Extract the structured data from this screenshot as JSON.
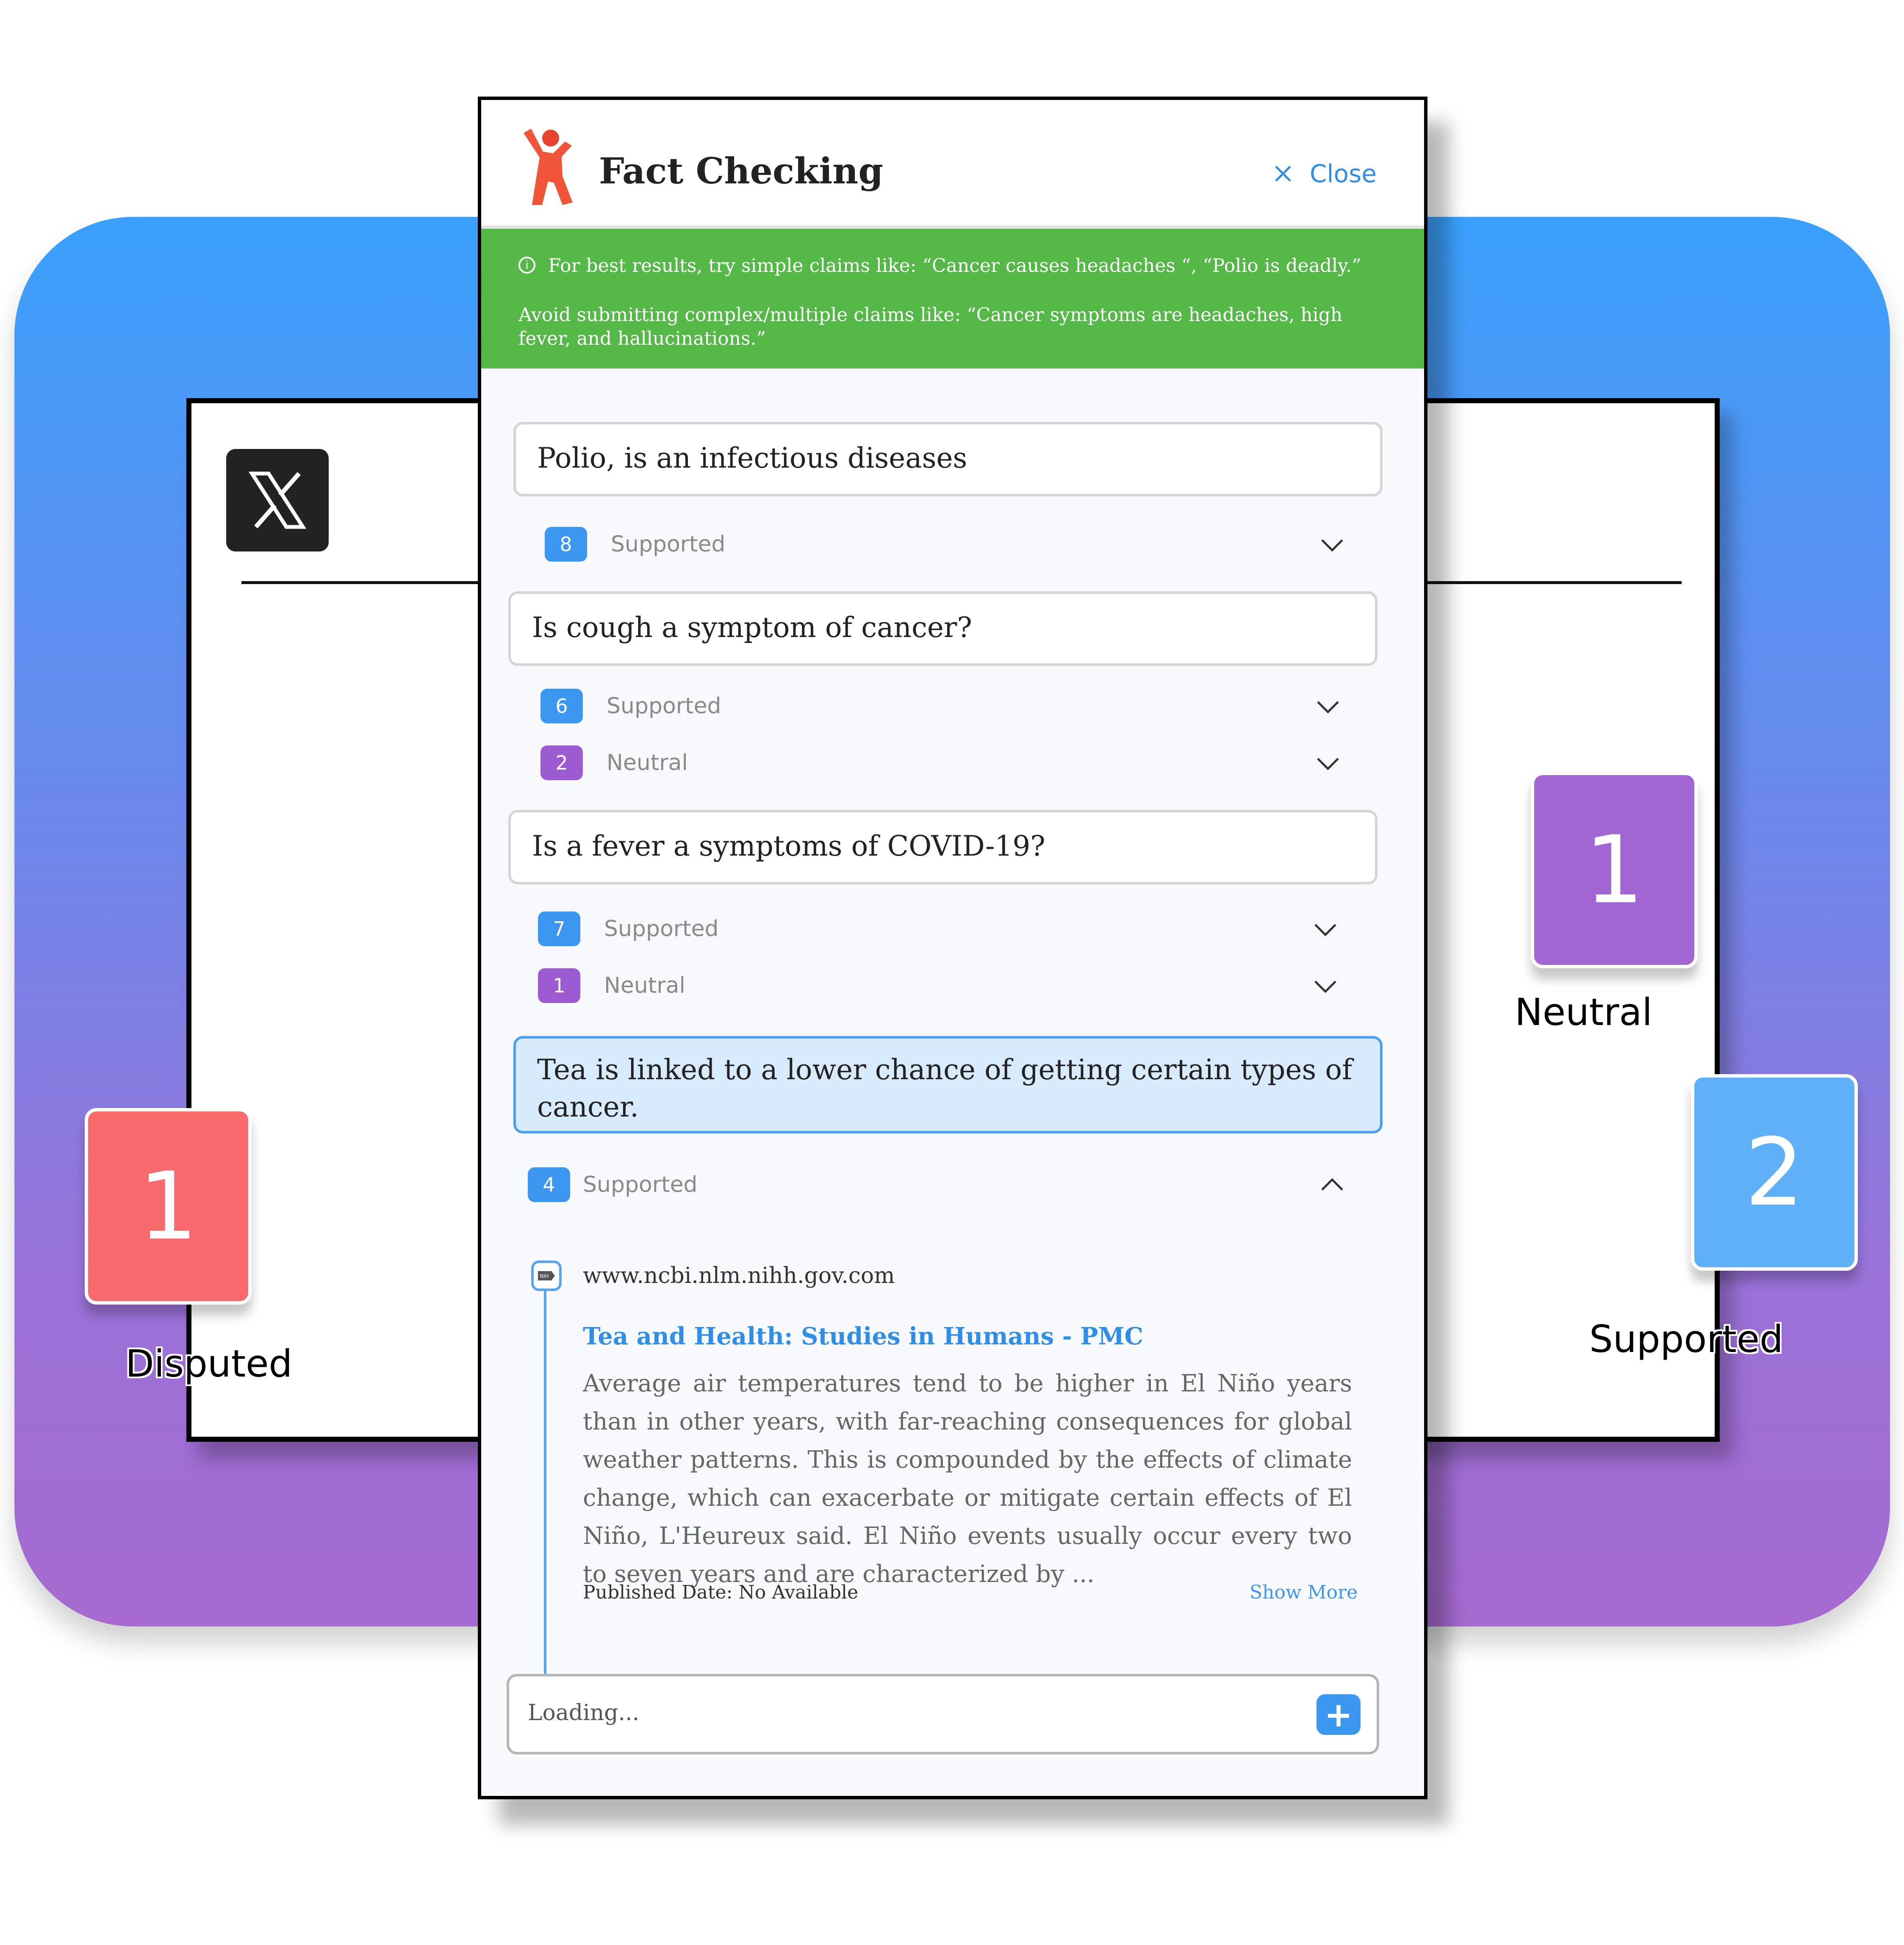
{
  "app": {
    "title": "Fact Checking",
    "close_label": "Close"
  },
  "banner": {
    "line1": "For best results, try simple claims like: “Cancer causes headaches “,  “Polio is deadly.”",
    "line2": "Avoid submitting complex/multiple claims like: “Cancer symptoms are headaches, high fever, and hallucinations.”"
  },
  "claims": [
    {
      "text": "Polio,  is an infectious diseases",
      "results": [
        {
          "count": "8",
          "label": "Supported",
          "color": "#3c97f1"
        }
      ]
    },
    {
      "text": "Is cough a symptom of cancer?",
      "results": [
        {
          "count": "6",
          "label": "Supported",
          "color": "#3c97f1"
        },
        {
          "count": "2",
          "label": "Neutral",
          "color": "#9d5bd2"
        }
      ]
    },
    {
      "text": "Is a fever a symptoms of COVID-19?",
      "results": [
        {
          "count": "7",
          "label": "Supported",
          "color": "#3c97f1"
        },
        {
          "count": "1",
          "label": "Neutral",
          "color": "#9d5bd2"
        }
      ]
    },
    {
      "text": "Tea is linked to a lower chance of getting certain types of cancer.",
      "results": [
        {
          "count": "4",
          "label": "Supported",
          "color": "#3c97f1",
          "expanded": true
        }
      ]
    }
  ],
  "source": {
    "icon_label": "NIH",
    "url": "www.ncbi.nlm.nihh.gov.com",
    "title": "Tea and Health: Studies in Humans - PMC",
    "body": "Average air temperatures tend to be higher in El Niño years than in other years, with far-reaching consequences for global weather patterns. This is compounded by the effects of climate change, which can exacerbate or mitigate certain effects of El Niño, L'Heureux said. El Niño events usually occur every two to seven years and are characterized by ...",
    "published": "Published Date: No Available",
    "show_more": "Show More"
  },
  "input": {
    "value": "Loading...",
    "add_symbol": "+"
  },
  "stats": {
    "disputed": {
      "count": "1",
      "label": "Disputed",
      "color": "#f86a6c"
    },
    "neutral": {
      "count": "1",
      "label": "Neutral",
      "color": "#a266d2"
    },
    "supported": {
      "count": "2",
      "label": "Supported",
      "color": "#5fb0f6"
    }
  },
  "icons": {
    "logo": "fact-check-figure-logo",
    "x_logo": "x-logo-icon",
    "close": "close-icon",
    "info": "info-icon",
    "chevron_down": "chevron-down-icon",
    "chevron_up": "chevron-up-icon",
    "source": "nih-source-icon",
    "add": "plus-icon"
  }
}
